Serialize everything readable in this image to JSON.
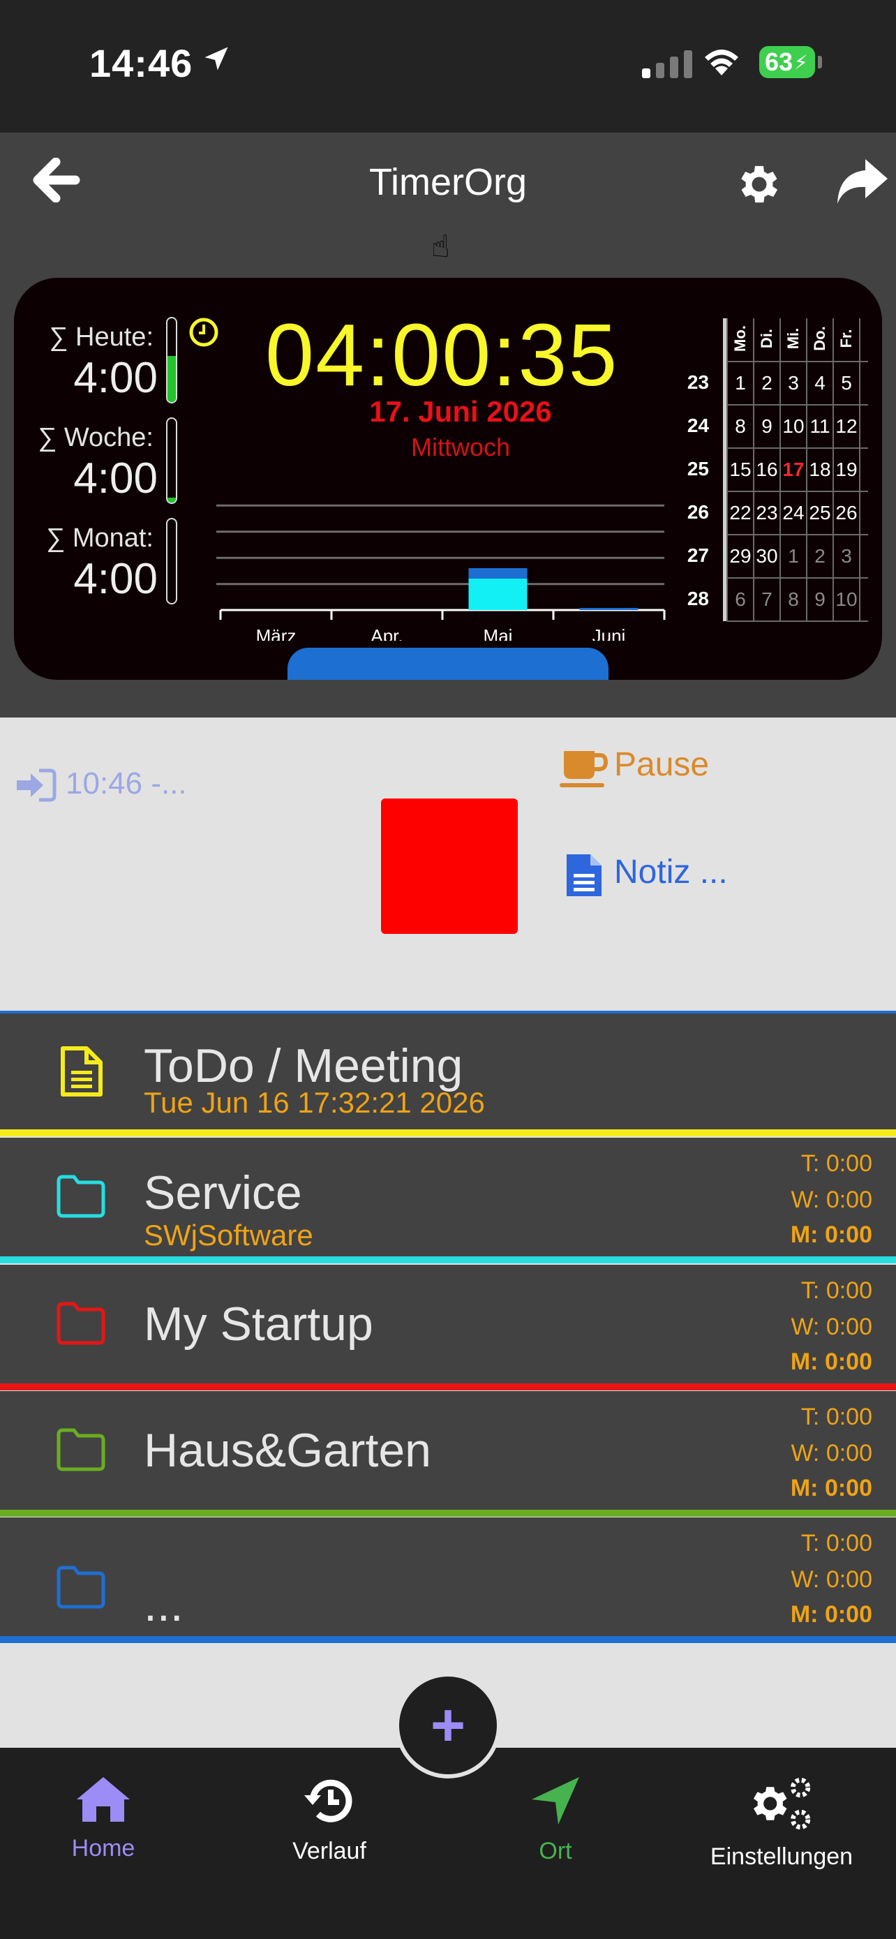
{
  "status_bar": {
    "time": "14:46",
    "battery": "63"
  },
  "header": {
    "title": "TimerOrg",
    "pointer_glyph": "☝"
  },
  "clock_card": {
    "sums": [
      {
        "label": "∑ Heute:",
        "value": "4:00",
        "fill": 0.55
      },
      {
        "label": "∑ Woche:",
        "value": "4:00",
        "fill": 0.06
      },
      {
        "label": "∑ Monat:",
        "value": "4:00",
        "fill": 0.0
      }
    ],
    "time": "04:00:35",
    "date": "17. Juni 2026",
    "weekday": "Mittwoch"
  },
  "chart_data": {
    "type": "bar",
    "categories": [
      "März",
      "Apr.",
      "Mai",
      "Juni"
    ],
    "series": [
      {
        "values": [
          0,
          0,
          2,
          0.1
        ],
        "color": "#1c6fd1"
      },
      {
        "values": [
          0,
          0,
          1.5,
          0
        ],
        "color": "#12f0f5"
      }
    ],
    "ylim": [
      0,
      5
    ],
    "grid": true
  },
  "calendar": {
    "headers": [
      "Mo.",
      "Di.",
      "Mi.",
      "Do.",
      "Fr."
    ],
    "weeks": [
      {
        "week": "23",
        "days": [
          {
            "d": "1"
          },
          {
            "d": "2"
          },
          {
            "d": "3"
          },
          {
            "d": "4"
          },
          {
            "d": "5"
          }
        ]
      },
      {
        "week": "24",
        "days": [
          {
            "d": "8"
          },
          {
            "d": "9"
          },
          {
            "d": "10"
          },
          {
            "d": "11"
          },
          {
            "d": "12"
          }
        ]
      },
      {
        "week": "25",
        "days": [
          {
            "d": "15"
          },
          {
            "d": "16"
          },
          {
            "d": "17",
            "today": true
          },
          {
            "d": "18"
          },
          {
            "d": "19"
          }
        ]
      },
      {
        "week": "26",
        "days": [
          {
            "d": "22"
          },
          {
            "d": "23"
          },
          {
            "d": "24"
          },
          {
            "d": "25"
          },
          {
            "d": "26"
          }
        ]
      },
      {
        "week": "27",
        "days": [
          {
            "d": "29"
          },
          {
            "d": "30"
          },
          {
            "d": "1",
            "other": true
          },
          {
            "d": "2",
            "other": true
          },
          {
            "d": "3",
            "other": true
          }
        ]
      },
      {
        "week": "28",
        "days": [
          {
            "d": "6",
            "other": true
          },
          {
            "d": "7",
            "other": true
          },
          {
            "d": "8",
            "other": true
          },
          {
            "d": "9",
            "other": true
          },
          {
            "d": "10",
            "other": true
          }
        ]
      }
    ]
  },
  "punch": {
    "clock_in": "10:46 -...",
    "pause_label": "Pause",
    "note_label": "Notiz ..."
  },
  "projects": [
    {
      "title": "ToDo / Meeting",
      "subtitle": "Tue Jun 16 17:32:21 2026",
      "icon": "document-icon",
      "color": "#f5eb1c",
      "t": "",
      "w": "",
      "m": ""
    },
    {
      "title": "Service",
      "subtitle": "SWjSoftware",
      "icon": "folder-icon",
      "color": "#27dde0",
      "t": "T: 0:00",
      "w": "W: 0:00",
      "m": "M: 0:00"
    },
    {
      "title": "My Startup",
      "subtitle": "",
      "icon": "folder-icon",
      "color": "#e51616",
      "t": "T: 0:00",
      "w": "W: 0:00",
      "m": "M: 0:00"
    },
    {
      "title": "Haus&Garten",
      "subtitle": "",
      "icon": "folder-icon",
      "color": "#6aad22",
      "t": "T: 0:00",
      "w": "W: 0:00",
      "m": "M: 0:00"
    },
    {
      "title": "...",
      "subtitle": "",
      "icon": "folder-icon",
      "color": "#1f6fd1",
      "t": "T: 0:00",
      "w": "W: 0:00",
      "m": "M: 0:00"
    }
  ],
  "tabbar": {
    "home": "Home",
    "verlauf": "Verlauf",
    "ort": "Ort",
    "settings": "Einstellungen",
    "fab": "+"
  },
  "colors": {
    "accent": "#9c8cf5",
    "ort": "#46b34f",
    "pause": "#d98a2c",
    "note": "#2e66dd"
  }
}
